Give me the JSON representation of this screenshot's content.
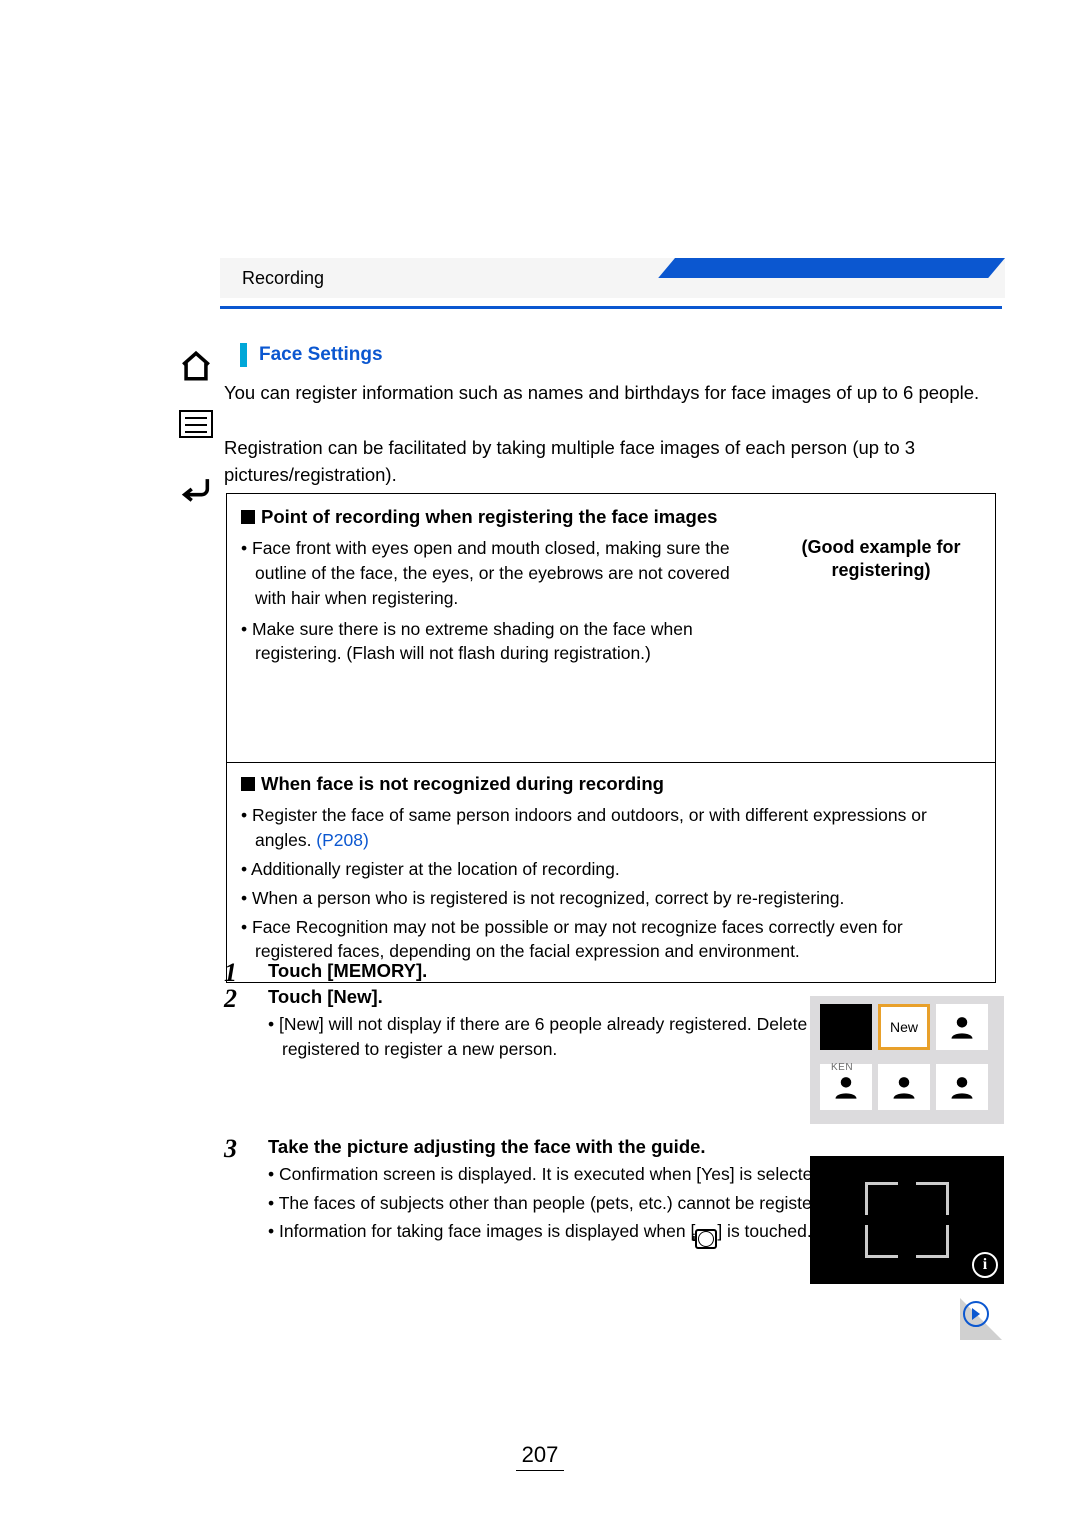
{
  "header": {
    "breadcrumb": "Recording"
  },
  "nav": {
    "home": "home-icon",
    "toc": "contents-icon",
    "back": "back-icon"
  },
  "section": {
    "title": "Face Settings",
    "intro1": "You can register information such as names and birthdays for face images of up to 6 people.",
    "intro2": "Registration can be facilitated by taking multiple face images of each person (up to 3 pictures/registration)."
  },
  "box": {
    "h1": "Point of recording when registering the face images",
    "bullets1": [
      "Face front with eyes open and mouth closed, making sure the outline of the face, the eyes, or the eyebrows are not covered with hair when registering.",
      "Make sure there is no extreme shading on the face when registering. (Flash will not flash during registration.)"
    ],
    "good_example": "(Good example for registering)",
    "h2": "When face is not recognized during recording",
    "bullets2_pre": "Register the face of same person indoors and outdoors, or with different expressions or angles. ",
    "bullets2_link": "(P208)",
    "bullets2_rest": [
      "Additionally register at the location of recording.",
      "When a person who is registered is not recognized, correct by re-registering.",
      "Face Recognition may not be possible or may not recognize faces correctly even for registered faces, depending on the facial expression and environment."
    ]
  },
  "steps": {
    "s1": {
      "num": "1",
      "title": "Touch [MEMORY]."
    },
    "s2": {
      "num": "2",
      "title": "Touch [New].",
      "bullets": [
        "[New] will not display if there are 6 people already registered. Delete a person already registered to register a new person."
      ]
    },
    "s3": {
      "num": "3",
      "title": "Take the picture adjusting the face with the guide.",
      "bullets_pre": [
        "Confirmation screen is displayed. It is executed when [Yes] is selected.",
        "The faces of subjects other than people (pets, etc.) cannot be registered."
      ],
      "bullets_info_pre": "Information for taking face images is displayed when [",
      "bullets_info_post": "] is touched."
    }
  },
  "fig1": {
    "new_label": "New",
    "ken_label": "KEN"
  },
  "page_number": "207"
}
